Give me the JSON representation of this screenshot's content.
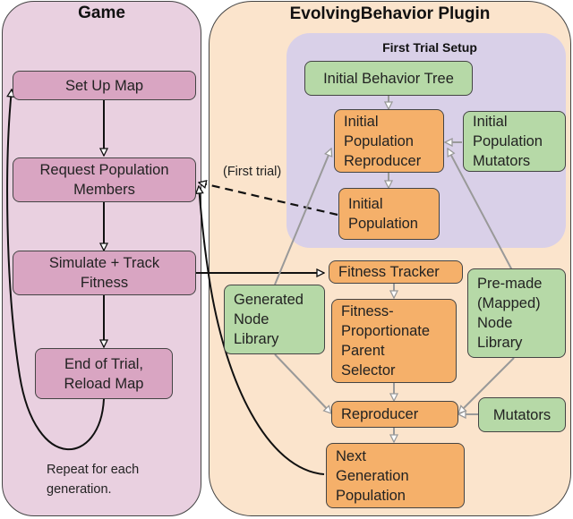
{
  "game": {
    "title": "Game",
    "nodes": {
      "set_up_map": "Set Up Map",
      "request_population": "Request Population\nMembers",
      "simulate_track": "Simulate + Track\nFitness",
      "end_of_trial": "End of Trial,\nReload Map"
    },
    "repeat_note": "Repeat for each\ngeneration."
  },
  "plugin": {
    "title": "EvolvingBehavior Plugin",
    "first_trial_setup": {
      "title": "First Trial Setup",
      "nodes": {
        "initial_behavior_tree": "Initial Behavior Tree",
        "initial_population_reproducer": "Initial\nPopulation\nReproducer",
        "initial_population_mutators": "Initial\nPopulation\nMutators",
        "initial_population": "Initial\nPopulation"
      }
    },
    "nodes": {
      "fitness_tracker": "Fitness Tracker",
      "generated_node_library": "Generated\nNode\nLibrary",
      "fitness_proportionate_parent_selector": "Fitness-\nProportionate\nParent\nSelector",
      "premade_node_library": "Pre-made\n(Mapped)\nNode\nLibrary",
      "reproducer": "Reproducer",
      "mutators": "Mutators",
      "next_generation_population": "Next\nGeneration\nPopulation"
    }
  },
  "edge_labels": {
    "first_trial": "(First trial)"
  },
  "colors": {
    "game_panel": "#e9d0e0",
    "game_node": "#d9a5c2",
    "plugin_panel": "#fbe4cc",
    "setup_panel": "#d9d0e8",
    "green_node": "#b6d9a7",
    "orange_node": "#f5b06a",
    "black_arrow": "#111111",
    "gray_arrow": "#999999"
  }
}
